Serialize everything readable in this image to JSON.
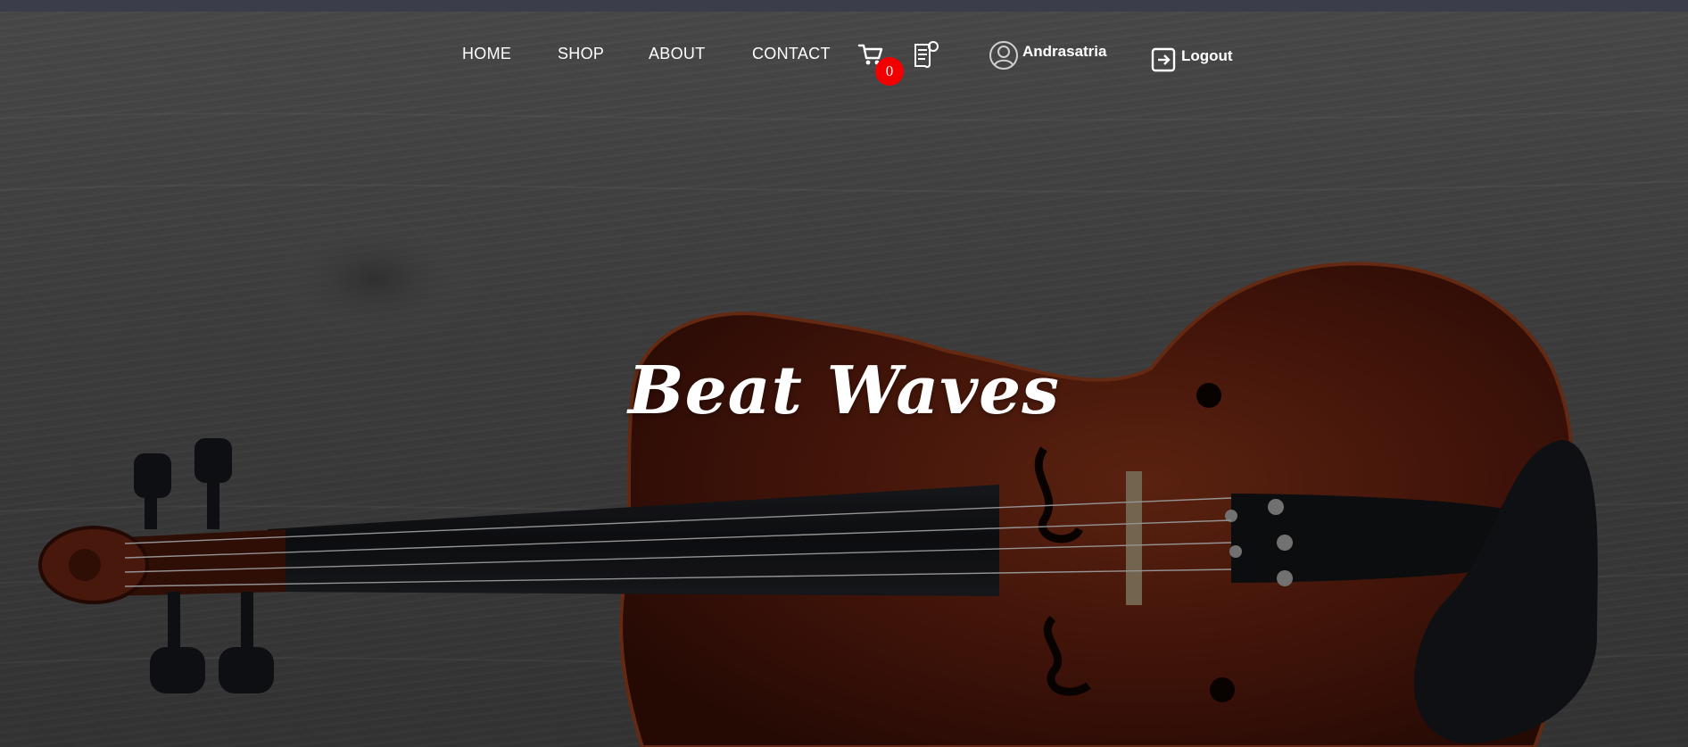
{
  "nav": {
    "links": [
      {
        "label": "HOME"
      },
      {
        "label": "SHOP"
      },
      {
        "label": "ABOUT"
      },
      {
        "label": "CONTACT"
      }
    ],
    "cart": {
      "icon": "cart-icon",
      "count": "0",
      "badge_color": "#f20000"
    },
    "orders": {
      "icon": "receipt-icon"
    },
    "user": {
      "icon": "user-avatar-icon",
      "name": "Andrasatria"
    },
    "logout": {
      "icon": "logout-icon",
      "label": "Logout"
    }
  },
  "hero": {
    "title": "Beat Waves",
    "image": "violin-on-wooden-table"
  },
  "colors": {
    "top_strip": "#3b3d4a",
    "nav_text": "#ffffff",
    "violin_body": "#5a1e10"
  }
}
